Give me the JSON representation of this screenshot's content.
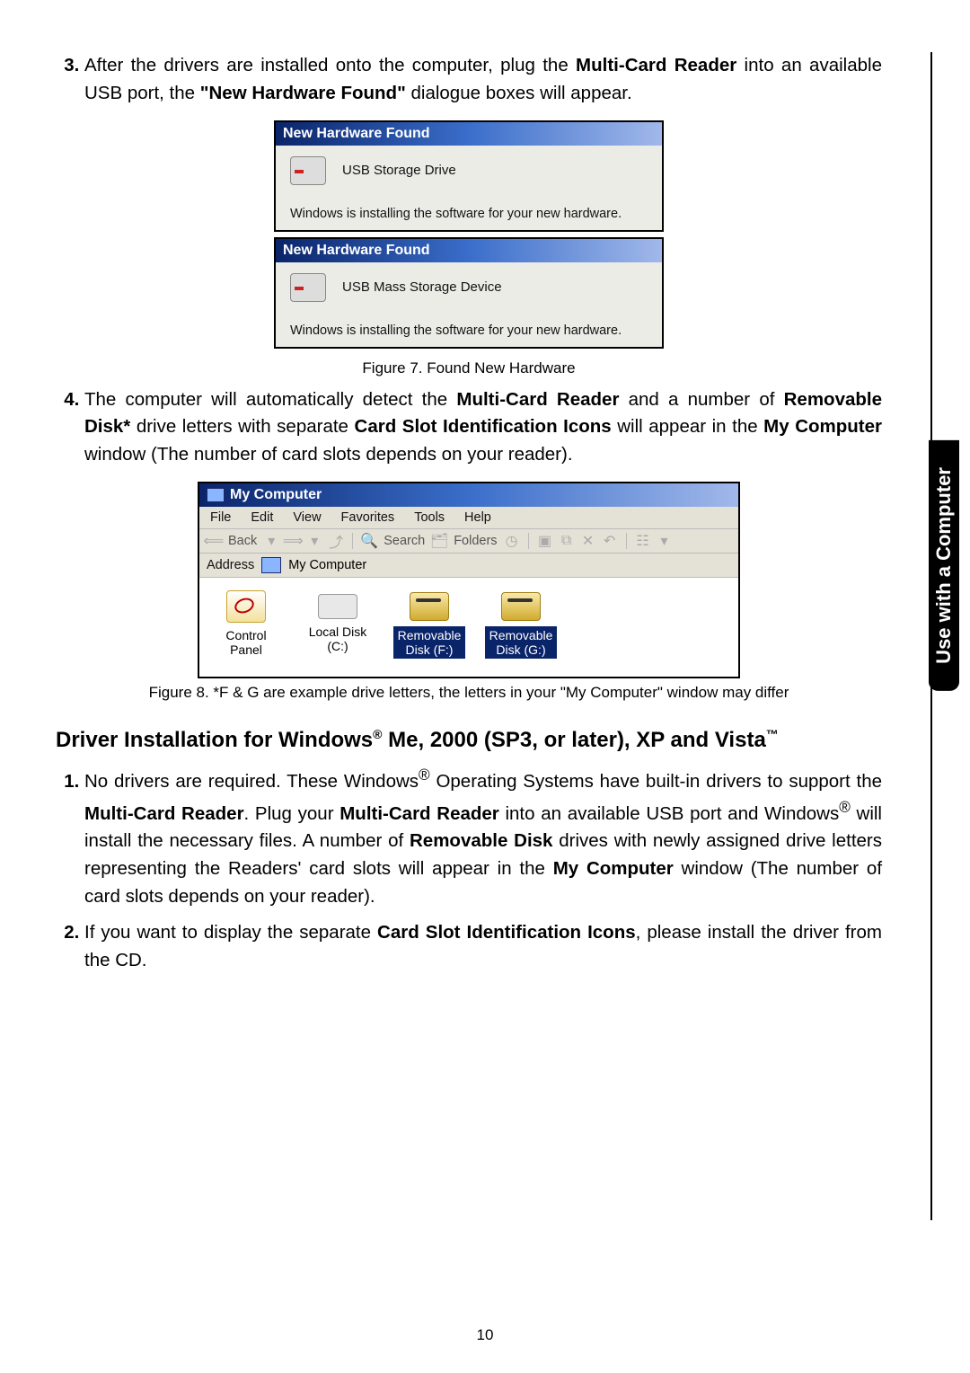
{
  "sideTab": "Use with a Computer",
  "item3": {
    "pre": "After the drivers are installed onto the computer, plug the ",
    "b1": "Multi-Card Reader",
    "mid": " into an available USB port, the ",
    "b2": "\"New Hardware Found\"",
    "post": " dialogue boxes will appear."
  },
  "dlg": {
    "title": "New Hardware Found",
    "dev1": "USB Storage Drive",
    "dev2": "USB Mass Storage Device",
    "status": "Windows is installing the software for your new hardware."
  },
  "fig7": "Figure 7. Found New Hardware",
  "item4": {
    "t1": "The computer will automatically detect the ",
    "b1": "Multi-Card Reader",
    "t2": " and a number of ",
    "b2": "Removable Disk*",
    "t3": " drive letters with separate ",
    "b3": "Card Slot Identification Icons",
    "t4": " will appear in the ",
    "b4": "My Computer",
    "t5": " window (The number of card slots depends on your reader)."
  },
  "mc": {
    "title": "My Computer",
    "menu": {
      "file": "File",
      "edit": "Edit",
      "view": "View",
      "fav": "Favorites",
      "tools": "Tools",
      "help": "Help"
    },
    "tb": {
      "back": "Back",
      "search": "Search",
      "folders": "Folders"
    },
    "addr": {
      "label": "Address",
      "value": "My Computer"
    },
    "icons": {
      "cp": "Control Panel",
      "c": "Local Disk (C:)",
      "f": "Removable Disk (F:)",
      "g": "Removable Disk (G:)"
    }
  },
  "fig8": "Figure 8. *F & G are example drive letters, the letters in your \"My Computer\" window may differ",
  "heading": {
    "pre": "Driver Installation for Windows",
    "reg": "®",
    "mid": " Me, 2000 (SP3, or later), XP and Vista",
    "tm": "™"
  },
  "secItem1": {
    "t1": "No drivers are required. These Windows",
    "r1": "®",
    "t2": " Operating Systems have built-in drivers to support the ",
    "b1": "Multi-Card Reader",
    "t3": ". Plug your ",
    "b2": "Multi-Card Reader",
    "t4": " into an available USB port and Windows",
    "r2": "®",
    "t5": " will install the necessary files. A number of ",
    "b3": "Removable Disk",
    "t6": " drives with newly assigned drive letters representing the Readers' card slots will appear in the ",
    "b4": "My Computer",
    "t7": " window (The number of card slots depends on your reader)."
  },
  "secItem2": {
    "t1": "If you want to display the separate ",
    "b1": "Card Slot Identification Icons",
    "t2": ", please install the driver from the CD."
  },
  "pageNumber": "10"
}
